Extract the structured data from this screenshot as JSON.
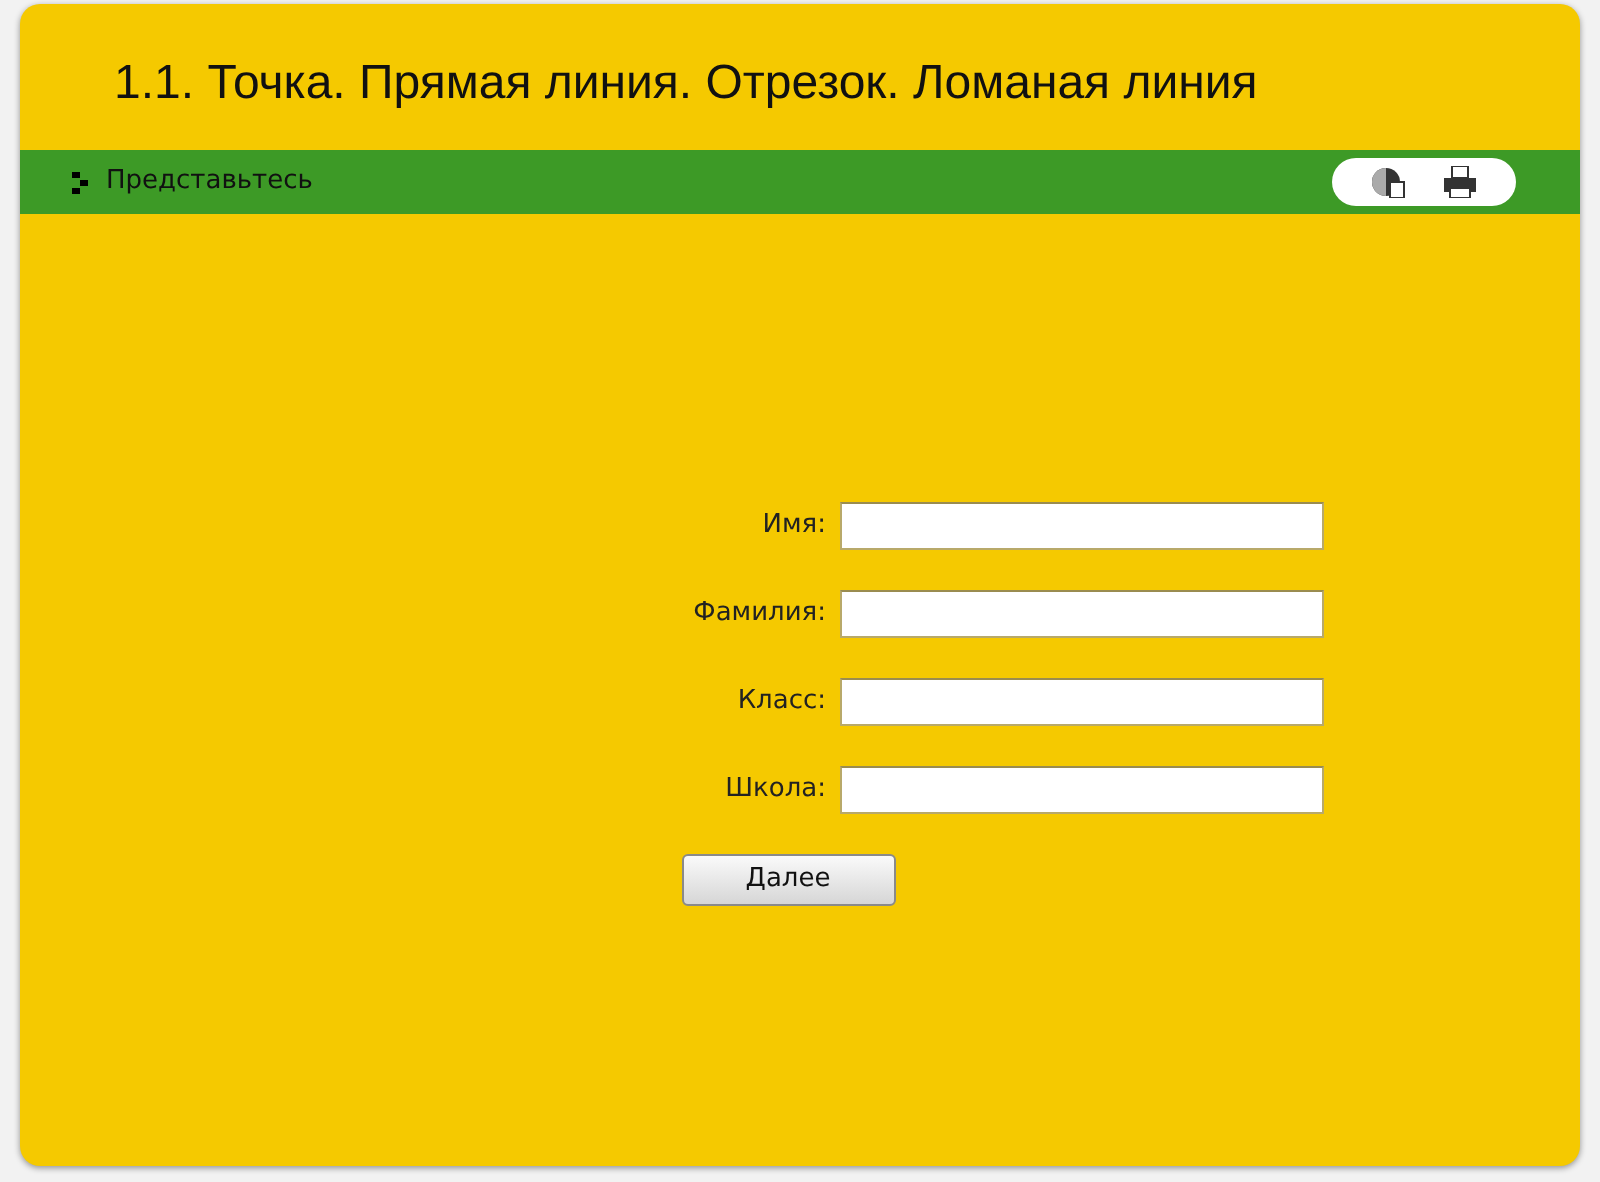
{
  "title": "1.1. Точка. Прямая линия. Отрезок. Ломаная линия",
  "toolbar": {
    "label": "Представьтесь"
  },
  "form": {
    "fields": [
      {
        "label": "Имя:"
      },
      {
        "label": "Фамилия:"
      },
      {
        "label": "Класс:"
      },
      {
        "label": "Школа:"
      }
    ],
    "button": "Далее"
  }
}
